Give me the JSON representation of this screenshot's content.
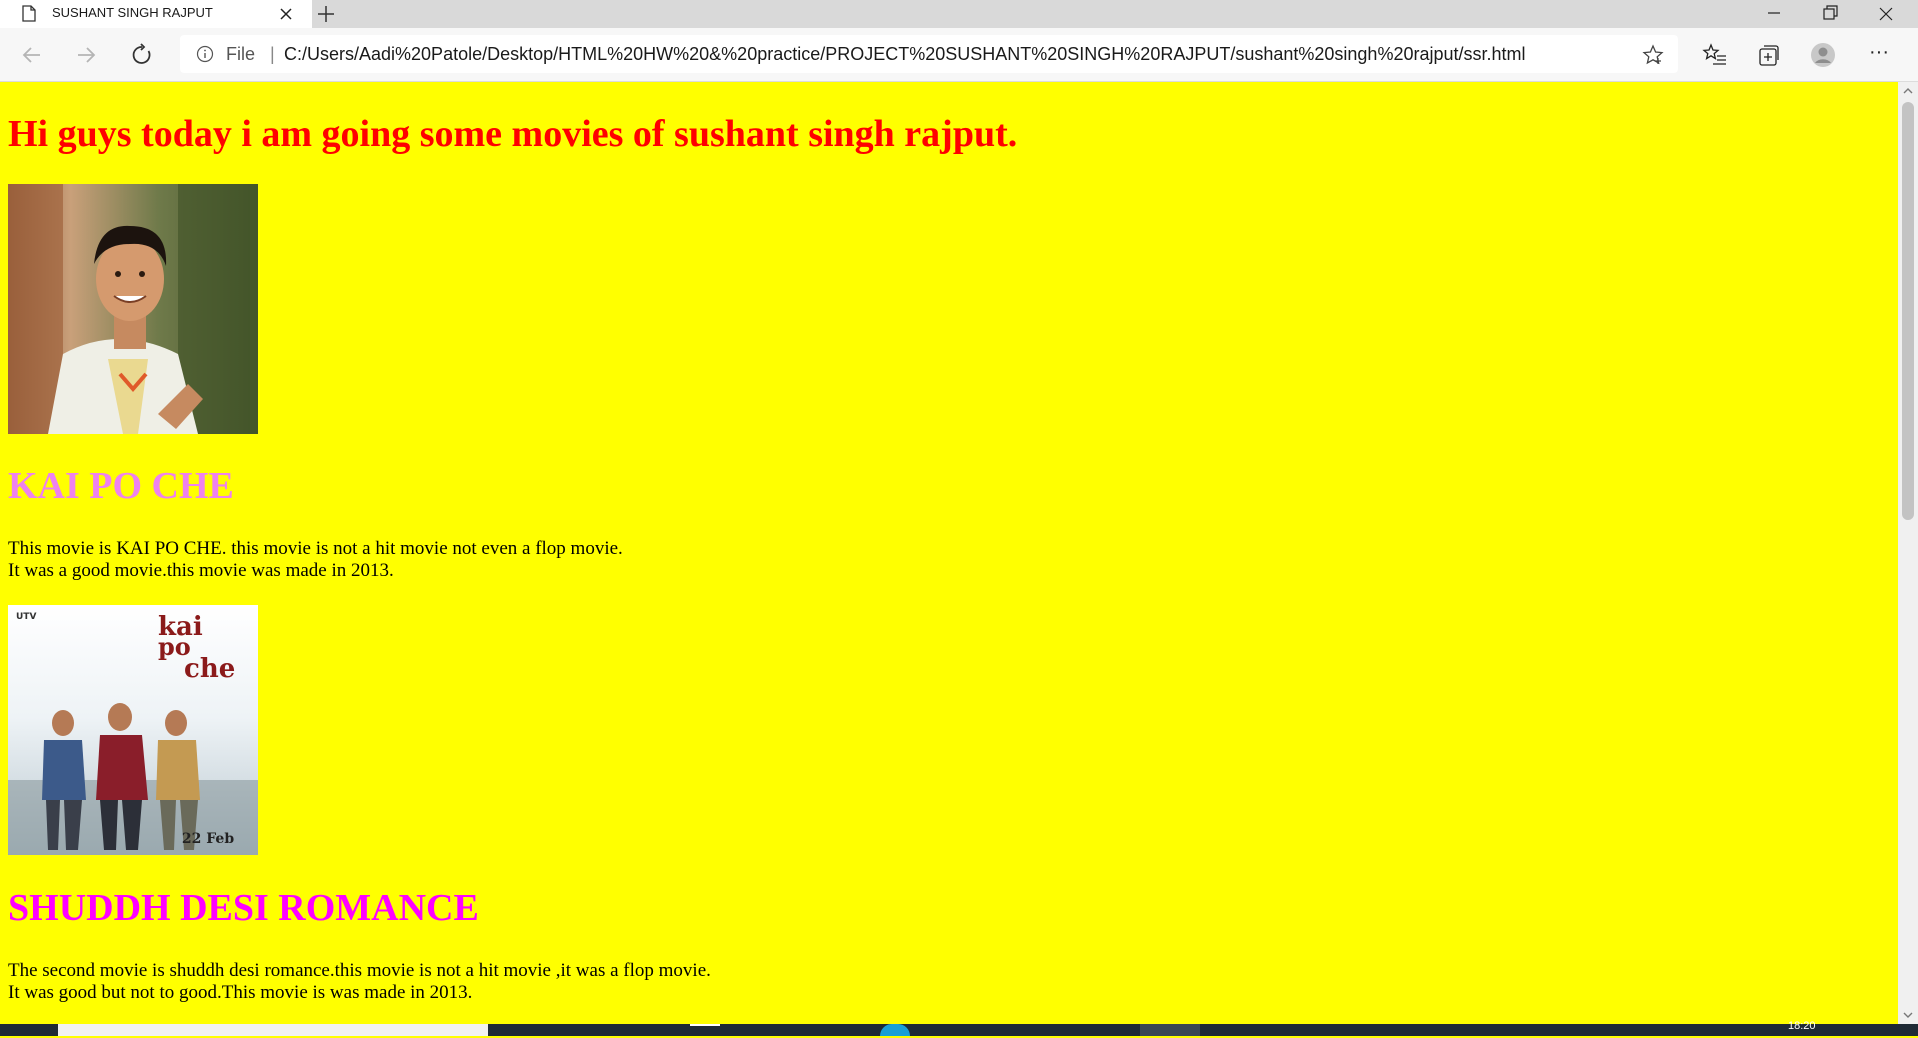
{
  "browser": {
    "tab_title": "SUSHANT SINGH RAJPUT",
    "scheme_label": "File",
    "address_separator": "|",
    "url": "C:/Users/Aadi%20Patole/Desktop/HTML%20HW%20&%20practice/PROJECT%20SUSHANT%20SINGH%20RAJPUT/sushant%20singh%20rajput/ssr.html",
    "more_label": "···"
  },
  "page": {
    "heading": "Hi guys today i am going some movies of sushant singh rajput.",
    "movies": [
      {
        "title": "KAI PO CHE",
        "title_color": "#ee82ee",
        "description_lines": [
          "This movie is KAI PO CHE. this movie is not a hit movie not even a flop movie.",
          "It was a good movie.this movie was made in 2013."
        ],
        "poster_text": {
          "studio": "UTV",
          "title_line_1": "kai",
          "title_line_2": "po",
          "title_line_3": "che",
          "release": "22 Feb"
        }
      },
      {
        "title": "SHUDDH DESI ROMANCE",
        "title_color": "#ff00ff",
        "description_lines": [
          "The second movie is shuddh desi romance.this movie is not a hit movie ,it was a flop movie.",
          "It was good but not to good.This movie is was made in 2013."
        ]
      }
    ]
  },
  "taskbar": {
    "clock": "18:20"
  },
  "colors": {
    "page_background": "#ffff00",
    "heading": "#ff0000"
  }
}
